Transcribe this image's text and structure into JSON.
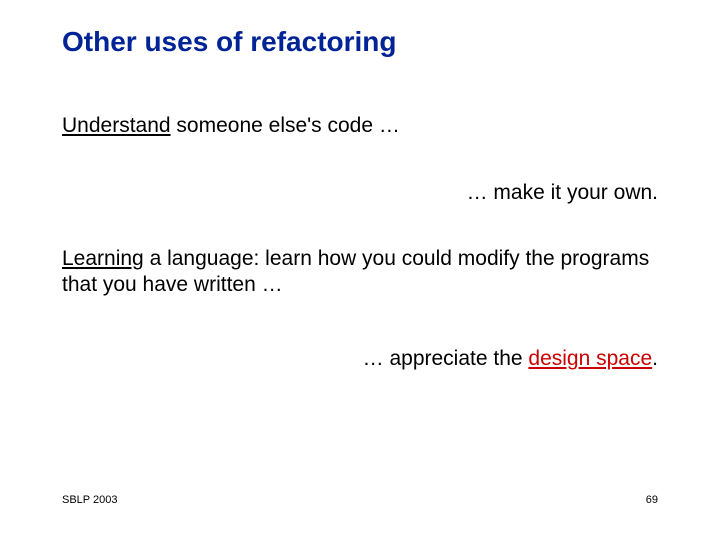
{
  "title": "Other uses of refactoring",
  "lines": {
    "l1_prefix": "Understand",
    "l1_rest": " someone else's code …",
    "l2": "… make it your own.",
    "l3_prefix": "Learning",
    "l3_rest": " a language: learn how you could modify the programs that you have written …",
    "l4_prefix": "… appreciate the ",
    "l4_emph": "design space",
    "l4_suffix": "."
  },
  "footer": {
    "left": "SBLP 2003",
    "right": "69"
  }
}
